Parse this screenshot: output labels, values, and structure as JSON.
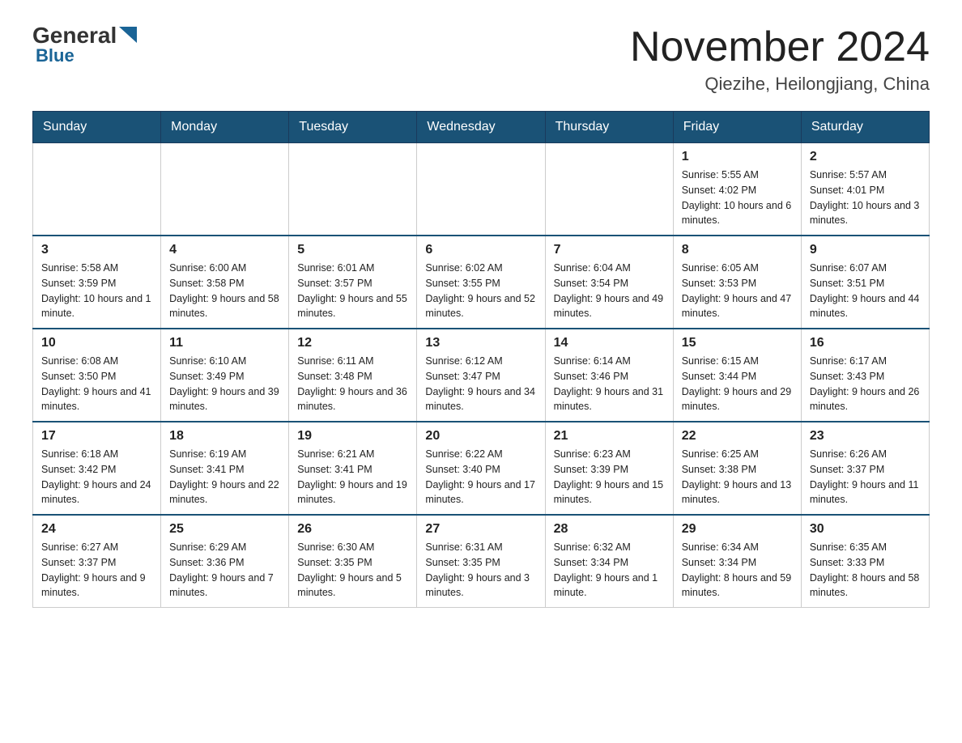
{
  "logo": {
    "general": "General",
    "blue": "Blue"
  },
  "title": "November 2024",
  "subtitle": "Qiezihe, Heilongjiang, China",
  "weekdays": [
    "Sunday",
    "Monday",
    "Tuesday",
    "Wednesday",
    "Thursday",
    "Friday",
    "Saturday"
  ],
  "weeks": [
    [
      {
        "day": "",
        "info": ""
      },
      {
        "day": "",
        "info": ""
      },
      {
        "day": "",
        "info": ""
      },
      {
        "day": "",
        "info": ""
      },
      {
        "day": "",
        "info": ""
      },
      {
        "day": "1",
        "info": "Sunrise: 5:55 AM\nSunset: 4:02 PM\nDaylight: 10 hours and 6 minutes."
      },
      {
        "day": "2",
        "info": "Sunrise: 5:57 AM\nSunset: 4:01 PM\nDaylight: 10 hours and 3 minutes."
      }
    ],
    [
      {
        "day": "3",
        "info": "Sunrise: 5:58 AM\nSunset: 3:59 PM\nDaylight: 10 hours and 1 minute."
      },
      {
        "day": "4",
        "info": "Sunrise: 6:00 AM\nSunset: 3:58 PM\nDaylight: 9 hours and 58 minutes."
      },
      {
        "day": "5",
        "info": "Sunrise: 6:01 AM\nSunset: 3:57 PM\nDaylight: 9 hours and 55 minutes."
      },
      {
        "day": "6",
        "info": "Sunrise: 6:02 AM\nSunset: 3:55 PM\nDaylight: 9 hours and 52 minutes."
      },
      {
        "day": "7",
        "info": "Sunrise: 6:04 AM\nSunset: 3:54 PM\nDaylight: 9 hours and 49 minutes."
      },
      {
        "day": "8",
        "info": "Sunrise: 6:05 AM\nSunset: 3:53 PM\nDaylight: 9 hours and 47 minutes."
      },
      {
        "day": "9",
        "info": "Sunrise: 6:07 AM\nSunset: 3:51 PM\nDaylight: 9 hours and 44 minutes."
      }
    ],
    [
      {
        "day": "10",
        "info": "Sunrise: 6:08 AM\nSunset: 3:50 PM\nDaylight: 9 hours and 41 minutes."
      },
      {
        "day": "11",
        "info": "Sunrise: 6:10 AM\nSunset: 3:49 PM\nDaylight: 9 hours and 39 minutes."
      },
      {
        "day": "12",
        "info": "Sunrise: 6:11 AM\nSunset: 3:48 PM\nDaylight: 9 hours and 36 minutes."
      },
      {
        "day": "13",
        "info": "Sunrise: 6:12 AM\nSunset: 3:47 PM\nDaylight: 9 hours and 34 minutes."
      },
      {
        "day": "14",
        "info": "Sunrise: 6:14 AM\nSunset: 3:46 PM\nDaylight: 9 hours and 31 minutes."
      },
      {
        "day": "15",
        "info": "Sunrise: 6:15 AM\nSunset: 3:44 PM\nDaylight: 9 hours and 29 minutes."
      },
      {
        "day": "16",
        "info": "Sunrise: 6:17 AM\nSunset: 3:43 PM\nDaylight: 9 hours and 26 minutes."
      }
    ],
    [
      {
        "day": "17",
        "info": "Sunrise: 6:18 AM\nSunset: 3:42 PM\nDaylight: 9 hours and 24 minutes."
      },
      {
        "day": "18",
        "info": "Sunrise: 6:19 AM\nSunset: 3:41 PM\nDaylight: 9 hours and 22 minutes."
      },
      {
        "day": "19",
        "info": "Sunrise: 6:21 AM\nSunset: 3:41 PM\nDaylight: 9 hours and 19 minutes."
      },
      {
        "day": "20",
        "info": "Sunrise: 6:22 AM\nSunset: 3:40 PM\nDaylight: 9 hours and 17 minutes."
      },
      {
        "day": "21",
        "info": "Sunrise: 6:23 AM\nSunset: 3:39 PM\nDaylight: 9 hours and 15 minutes."
      },
      {
        "day": "22",
        "info": "Sunrise: 6:25 AM\nSunset: 3:38 PM\nDaylight: 9 hours and 13 minutes."
      },
      {
        "day": "23",
        "info": "Sunrise: 6:26 AM\nSunset: 3:37 PM\nDaylight: 9 hours and 11 minutes."
      }
    ],
    [
      {
        "day": "24",
        "info": "Sunrise: 6:27 AM\nSunset: 3:37 PM\nDaylight: 9 hours and 9 minutes."
      },
      {
        "day": "25",
        "info": "Sunrise: 6:29 AM\nSunset: 3:36 PM\nDaylight: 9 hours and 7 minutes."
      },
      {
        "day": "26",
        "info": "Sunrise: 6:30 AM\nSunset: 3:35 PM\nDaylight: 9 hours and 5 minutes."
      },
      {
        "day": "27",
        "info": "Sunrise: 6:31 AM\nSunset: 3:35 PM\nDaylight: 9 hours and 3 minutes."
      },
      {
        "day": "28",
        "info": "Sunrise: 6:32 AM\nSunset: 3:34 PM\nDaylight: 9 hours and 1 minute."
      },
      {
        "day": "29",
        "info": "Sunrise: 6:34 AM\nSunset: 3:34 PM\nDaylight: 8 hours and 59 minutes."
      },
      {
        "day": "30",
        "info": "Sunrise: 6:35 AM\nSunset: 3:33 PM\nDaylight: 8 hours and 58 minutes."
      }
    ]
  ]
}
